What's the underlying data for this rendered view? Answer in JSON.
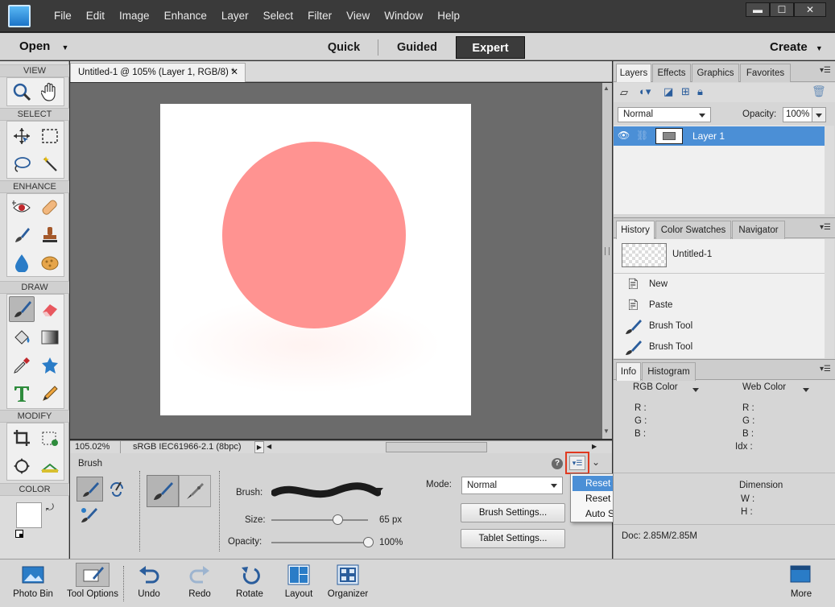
{
  "menubar": {
    "items": [
      "File",
      "Edit",
      "Image",
      "Enhance",
      "Layer",
      "Select",
      "Filter",
      "View",
      "Window",
      "Help"
    ],
    "win_buttons": [
      "▬",
      "☐",
      "✕"
    ]
  },
  "modebar": {
    "open": "Open",
    "tabs": [
      "Quick",
      "Guided",
      "Expert"
    ],
    "active_tab": "Expert",
    "create": "Create"
  },
  "toolbox": {
    "sections": [
      "VIEW",
      "SELECT",
      "ENHANCE",
      "DRAW",
      "MODIFY",
      "COLOR"
    ],
    "tools": [
      "zoom-tool",
      "hand-tool",
      "move-tool",
      "marquee-tool",
      "lasso-tool",
      "magic-wand-tool",
      "red-eye-tool",
      "healing-tool",
      "smart-brush-tool",
      "clone-stamp-tool",
      "blur-tool",
      "sponge-tool",
      "brush-tool",
      "eraser-tool",
      "paint-bucket-tool",
      "gradient-tool",
      "eyedropper-tool",
      "custom-shape-tool",
      "type-tool",
      "pencil-tool",
      "crop-tool",
      "recompose-tool",
      "content-aware-move-tool",
      "straighten-tool"
    ]
  },
  "document": {
    "tab_title": "Untitled-1 @ 105% (Layer 1, RGB/8) *",
    "zoom": "105.02%",
    "profile": "sRGB IEC61966-2.1 (8bpc)",
    "circle_color": "#ff9391"
  },
  "tool_options": {
    "tool_name": "Brush",
    "brush_label": "Brush:",
    "size_label": "Size:",
    "size_value": "65 px",
    "size_fraction": 0.27,
    "opacity_label": "Opacity:",
    "opacity_value": "100%",
    "opacity_fraction": 1.0,
    "mode_label": "Mode:",
    "mode_value": "Normal",
    "brush_settings": "Brush Settings...",
    "tablet_settings": "Tablet Settings...",
    "help_glyph": "?"
  },
  "context_menu": {
    "items": [
      "Reset Tool",
      "Reset All Tools",
      "Auto Show Tool Options"
    ],
    "highlighted": "Reset Tool"
  },
  "layers_panel": {
    "tabs": [
      "Layers",
      "Effects",
      "Graphics",
      "Favorites"
    ],
    "blend_mode": "Normal",
    "opacity_label": "Opacity:",
    "opacity_value": "100%",
    "layers": [
      {
        "name": "Layer 1"
      }
    ]
  },
  "history_panel": {
    "tabs": [
      "History",
      "Color Swatches",
      "Navigator"
    ],
    "snapshot": "Untitled-1",
    "items": [
      "New",
      "Paste",
      "Brush Tool",
      "Brush Tool"
    ]
  },
  "info_panel": {
    "tabs": [
      "Info",
      "Histogram"
    ],
    "left_mode": "RGB Color",
    "right_mode": "Web Color",
    "left_labels": [
      "R :",
      "G :",
      "B :"
    ],
    "right_labels": [
      "R :",
      "G :",
      "B :",
      "Idx :"
    ],
    "dimension_label": "Dimension",
    "dim_labels": [
      "W :",
      "H :"
    ],
    "doc_size": "Doc: 2.85M/2.85M"
  },
  "bottombar": {
    "items": [
      "Photo Bin",
      "Tool Options",
      "Undo",
      "Redo",
      "Rotate",
      "Layout",
      "Organizer",
      "More"
    ]
  },
  "colors": {
    "accent": "#4b8fd6",
    "highlight_border": "#e0391f"
  }
}
